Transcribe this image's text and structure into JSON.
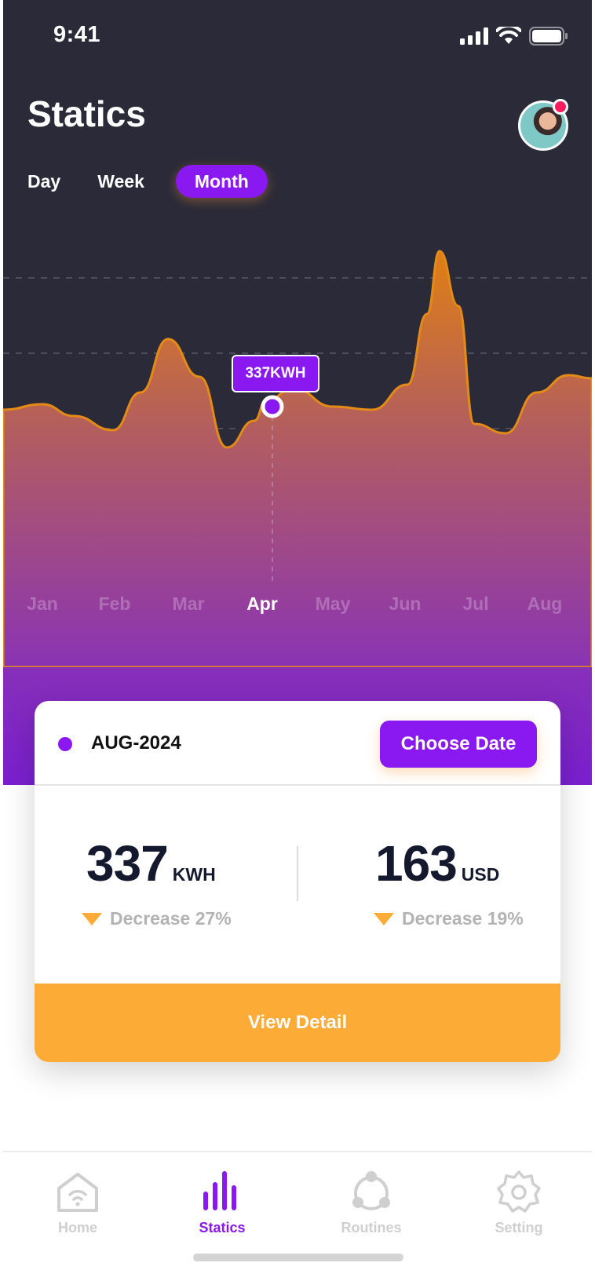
{
  "status_bar": {
    "time": "9:41"
  },
  "header": {
    "title": "Statics"
  },
  "period_tabs": [
    {
      "label": "Day",
      "active": false
    },
    {
      "label": "Week",
      "active": false
    },
    {
      "label": "Month",
      "active": true
    }
  ],
  "chart_data": {
    "type": "area",
    "categories": [
      "Jan",
      "Feb",
      "Mar",
      "Apr",
      "May",
      "Jun",
      "Jul",
      "Aug"
    ],
    "selected_category": "Apr",
    "tooltip": "337KWH",
    "grid": true
  },
  "summary_card": {
    "date_label": "AUG-2024",
    "choose_date_label": "Choose Date",
    "energy": {
      "value": "337",
      "unit": "KWH",
      "change": "Decrease 27%"
    },
    "cost": {
      "value": "163",
      "unit": "USD",
      "change": "Decrease 19%"
    },
    "view_detail_label": "View Detail"
  },
  "tab_bar": [
    {
      "label": "Home",
      "icon": "home-wifi-icon",
      "active": false
    },
    {
      "label": "Statics",
      "icon": "bar-chart-icon",
      "active": true
    },
    {
      "label": "Routines",
      "icon": "routines-icon",
      "active": false
    },
    {
      "label": "Setting",
      "icon": "gear-icon",
      "active": false
    }
  ],
  "colors": {
    "background_dark": "#2b2a38",
    "accent_purple": "#8a18f0",
    "accent_orange": "#fbab36",
    "badge_red": "#ff1b5c"
  }
}
